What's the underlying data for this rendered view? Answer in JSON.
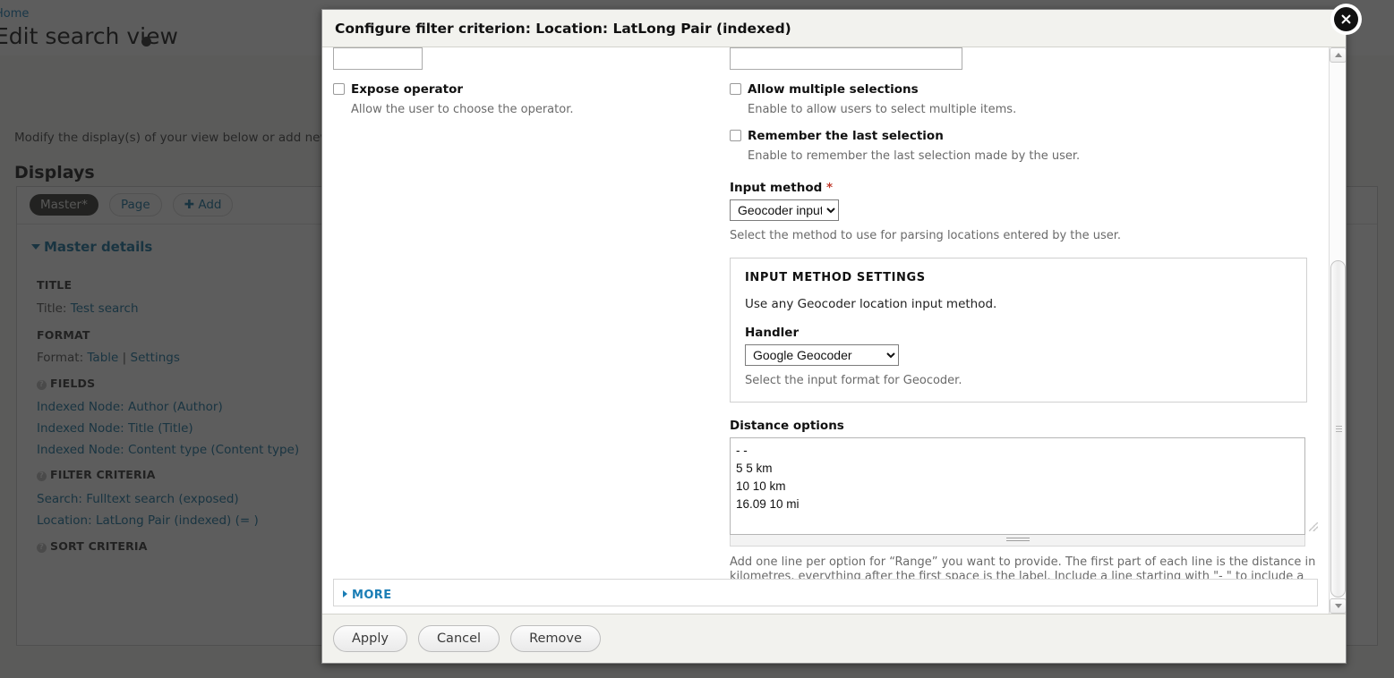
{
  "background": {
    "breadcrumb": "Home",
    "page_title": "Edit search view",
    "description": "Modify the display(s) of your view below or add new",
    "displays_heading": "Displays",
    "tabs": [
      {
        "label": "Master*",
        "state": "active"
      },
      {
        "label": "Page",
        "state": "normal"
      },
      {
        "label": "Add",
        "state": "add"
      }
    ],
    "details_toggle": "Master details",
    "sections": [
      {
        "heading": "TITLE",
        "has_help_icon": false,
        "rows": [
          {
            "prefix": "Title:",
            "links": [
              "Test search"
            ]
          }
        ]
      },
      {
        "heading": "FORMAT",
        "has_help_icon": false,
        "rows": [
          {
            "prefix": "Format:",
            "links": [
              "Table",
              "Settings"
            ]
          }
        ]
      },
      {
        "heading": "FIELDS",
        "has_help_icon": true,
        "rows": [
          {
            "prefix": "",
            "links": [
              "Indexed Node: Author (Author)"
            ]
          },
          {
            "prefix": "",
            "links": [
              "Indexed Node: Title (Title)"
            ]
          },
          {
            "prefix": "",
            "links": [
              "Indexed Node: Content type (Content type)"
            ]
          }
        ]
      },
      {
        "heading": "FILTER CRITERIA",
        "has_help_icon": true,
        "rows": [
          {
            "prefix": "",
            "links": [
              "Search: Fulltext search (exposed)"
            ]
          },
          {
            "prefix": "",
            "links": [
              "Location: LatLong Pair (indexed) (= )"
            ]
          }
        ]
      },
      {
        "heading": "SORT CRITERIA",
        "has_help_icon": true,
        "rows": []
      }
    ]
  },
  "modal": {
    "title": "Configure filter criterion: Location: LatLong Pair (indexed)",
    "close_icon": "close-icon",
    "left_column": {
      "text_input_value": "",
      "expose_operator": {
        "label": "Expose operator",
        "checked": false,
        "description": "Allow the user to choose the operator."
      }
    },
    "right_column": {
      "text_input_value": "",
      "allow_multiple": {
        "label": "Allow multiple selections",
        "checked": false,
        "description": "Enable to allow users to select multiple items."
      },
      "remember_last": {
        "label": "Remember the last selection",
        "checked": false,
        "description": "Enable to remember the last selection made by the user."
      },
      "input_method": {
        "label": "Input method",
        "required_marker": "*",
        "selected": "Geocoder input",
        "options": [
          "Geocoder input"
        ],
        "description": "Select the method to use for parsing locations entered by the user."
      },
      "input_method_settings": {
        "legend": "INPUT METHOD SETTINGS",
        "description": "Use any Geocoder location input method.",
        "handler": {
          "label": "Handler",
          "selected": "Google Geocoder",
          "options": [
            "Google Geocoder"
          ],
          "description": "Select the input format for Geocoder."
        }
      },
      "distance_options": {
        "label": "Distance options",
        "value": "- -\n5 5 km\n10 10 km\n16.09 10 mi",
        "help": "Add one line per option for “Range” you want to provide. The first part of each line is the distance in kilometres, everything after the first space is the label. Include a line starting with \"- \" to include a no-op option."
      }
    },
    "more": {
      "label": "MORE",
      "expanded": false
    },
    "footer_buttons": [
      {
        "label": "Apply",
        "name": "apply-button"
      },
      {
        "label": "Cancel",
        "name": "cancel-button"
      },
      {
        "label": "Remove",
        "name": "remove-button"
      }
    ]
  },
  "colors": {
    "link": "#0d6c9b",
    "accent": "#1a7db5",
    "required": "#c0392b",
    "overlay": "rgba(30,30,30,0.72)"
  }
}
